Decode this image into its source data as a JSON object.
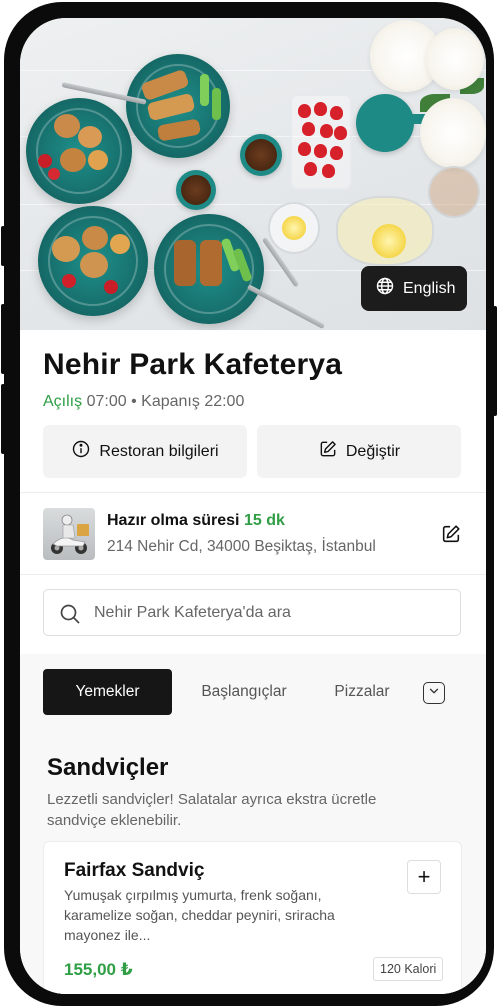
{
  "hero": {
    "language_button": {
      "label": "English",
      "icon": "globe-icon"
    }
  },
  "restaurant": {
    "name": "Nehir Park Kafeterya",
    "hours": {
      "open_label": "Açılış",
      "open_time": "07:00",
      "separator": "•",
      "close_label": "Kapanış",
      "close_time": "22:00"
    }
  },
  "actions": {
    "info": {
      "label": "Restoran bilgileri",
      "icon": "info-icon"
    },
    "change": {
      "label": "Değiştir",
      "icon": "edit-icon"
    }
  },
  "delivery": {
    "ready_label": "Hazır olma süresi",
    "ready_time": "15 dk",
    "address": "214 Nehir Cd, 34000 Beşiktaş, İstanbul",
    "thumbnail_icon": "courier-scooter-image",
    "edit_icon": "edit-icon"
  },
  "search": {
    "placeholder": "Nehir Park Kafeterya'da ara",
    "value": "",
    "icon": "search-icon"
  },
  "tabs": [
    {
      "label": "Yemekler",
      "active": true
    },
    {
      "label": "Başlangıçlar",
      "active": false
    },
    {
      "label": "Pizzalar",
      "active": false
    }
  ],
  "tabs_more_icon": "chevron-down-icon",
  "section": {
    "title": "Sandviçler",
    "description": "Lezzetli sandviçler! Salatalar ayrıca ekstra ücretle sandviçe eklenebilir."
  },
  "item": {
    "name": "Fairfax Sandviç",
    "description": "Yumuşak çırpılmış yumurta, frenk soğanı, karamelize soğan, cheddar peyniri, sriracha mayonez ile...",
    "price": "155,00 ₺",
    "calories": "120 Kalori",
    "add_label": "+"
  },
  "colors": {
    "accent_green": "#2f9e44",
    "dark_button": "#161616",
    "frame": "#0b0b0b"
  }
}
